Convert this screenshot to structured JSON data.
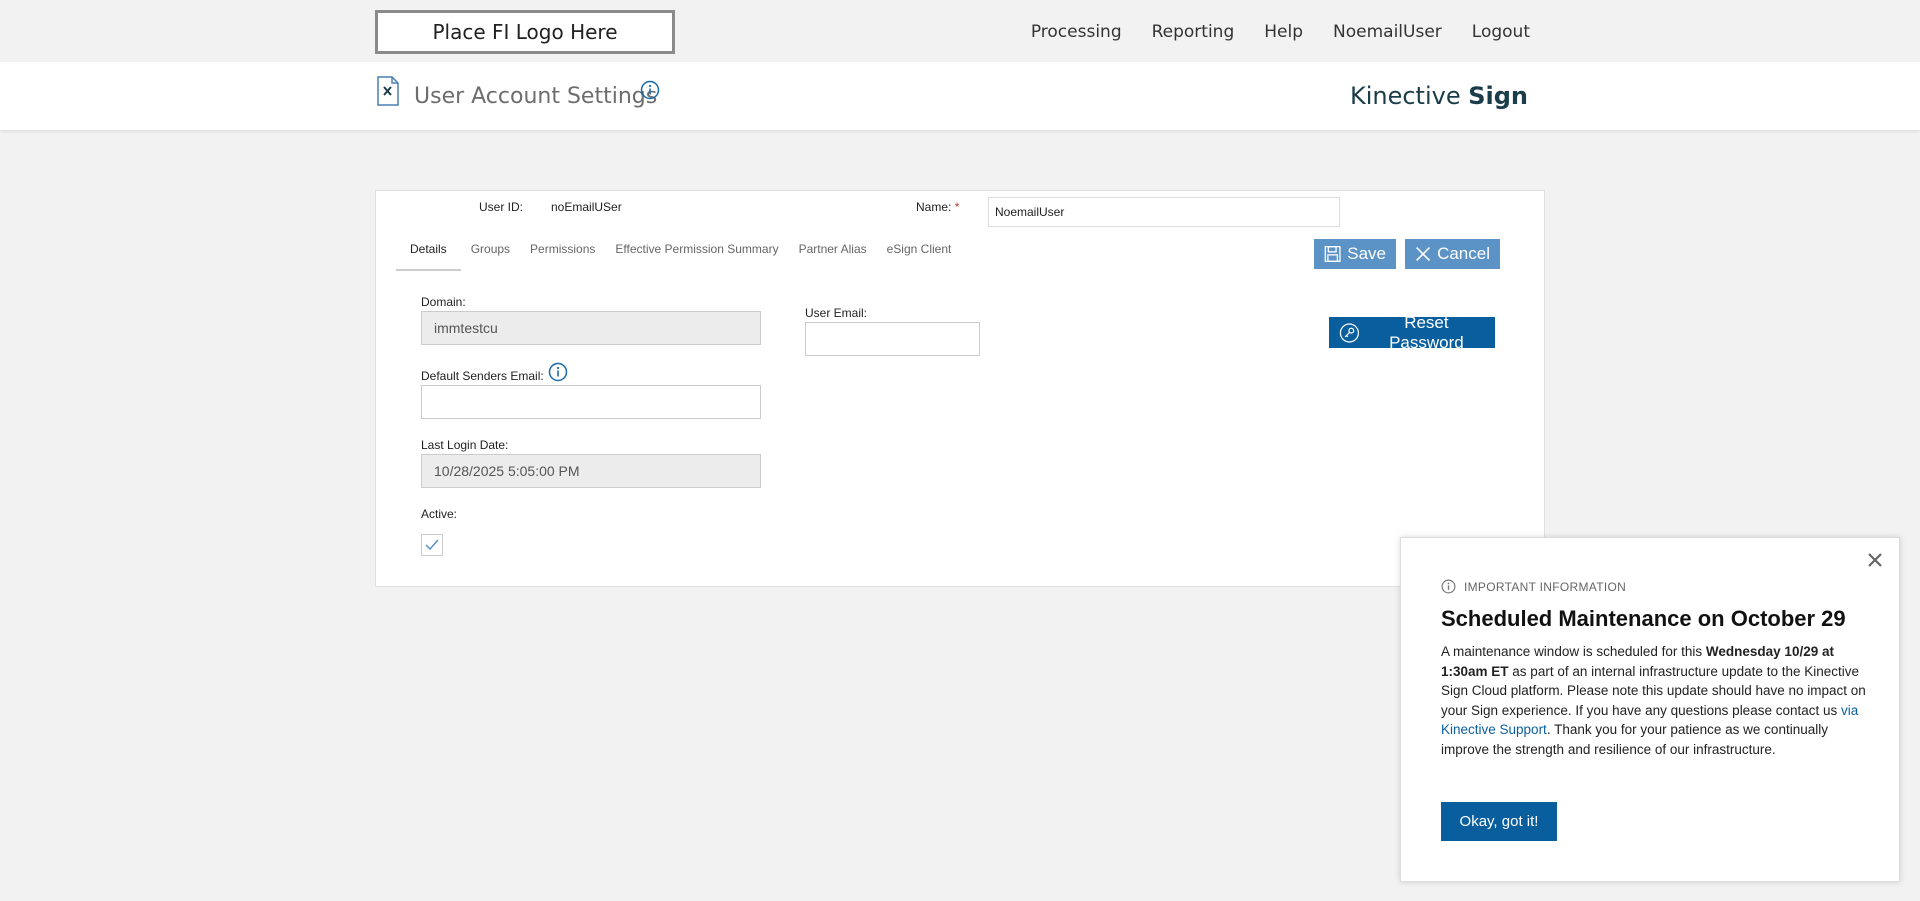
{
  "topbar": {
    "logo_text": "Place FI Logo Here",
    "nav": [
      "Processing",
      "Reporting",
      "Help",
      "NoemailUser",
      "Logout"
    ]
  },
  "header": {
    "title": "User Account Settings",
    "brand_light": "Kinective",
    "brand_bold": "Sign"
  },
  "form": {
    "user_id_label": "User ID:",
    "user_id_value": "noEmailUSer",
    "name_label": "Name:",
    "name_required": "*",
    "name_value": "NoemailUser",
    "tabs": [
      "Details",
      "Groups",
      "Permissions",
      "Effective Permission Summary",
      "Partner Alias",
      "eSign Client"
    ],
    "active_tab": "Details",
    "save_label": "Save",
    "cancel_label": "Cancel",
    "reset_label": "Reset Password",
    "domain_label": "Domain:",
    "domain_value": "immtestcu",
    "user_email_label": "User Email:",
    "user_email_value": "",
    "default_senders_label": "Default Senders Email:",
    "default_senders_value": "",
    "last_login_label": "Last Login Date:",
    "last_login_value": "10/28/2025 5:05:00 PM",
    "active_label": "Active:",
    "active_checked": true
  },
  "popup": {
    "kicker": "IMPORTANT INFORMATION",
    "title": "Scheduled Maintenance on October 29",
    "body_1": "A maintenance window is scheduled for this ",
    "body_bold": "Wednesday 10/29 at 1:30am ET",
    "body_2": " as part of an internal infrastructure update to the Kinective Sign Cloud platform. Please note this update should have no impact on your Sign experience. If you have any questions please contact us ",
    "body_link": "via Kinective Support",
    "body_3": ". Thank you for your patience as we continually improve the strength and resilience of our infrastructure.",
    "button_label": "Okay, got it!"
  },
  "colors": {
    "accent_blue": "#095f9e",
    "button_light_blue": "#5b93c7",
    "brand_dark": "#1b3d4a",
    "background": "#f2f2f2"
  }
}
